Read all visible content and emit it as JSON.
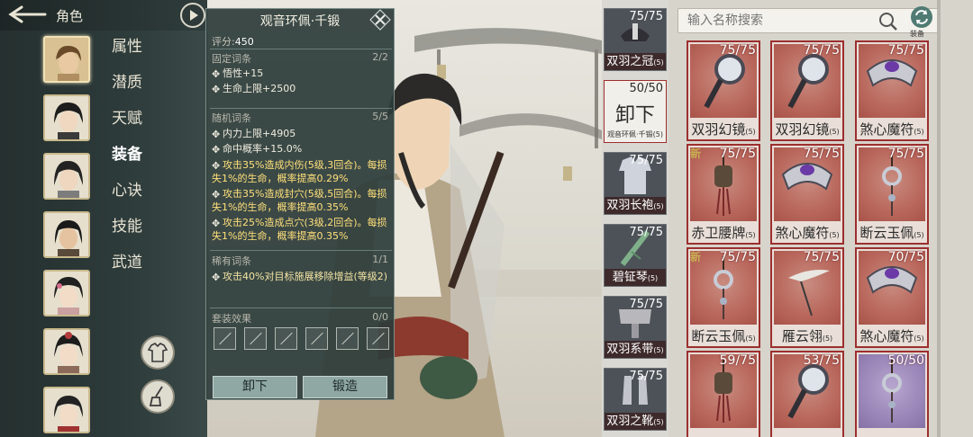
{
  "header": {
    "title": "角色"
  },
  "nav": {
    "items": [
      "属性",
      "潜质",
      "天赋",
      "装备",
      "心诀",
      "技能",
      "武道"
    ],
    "active": "装备"
  },
  "popup": {
    "title": "观音环佩·千锻",
    "score_label": "评分:",
    "score": "450",
    "fixed": {
      "label": "固定词条",
      "count": "2/2",
      "lines": [
        "悟性+15",
        "生命上限+2500"
      ]
    },
    "random": {
      "label": "随机词条",
      "count": "5/5",
      "lines": [
        "内力上限+4905",
        "命中概率+15.0%",
        "攻击35%造成内伤(5级,3回合)。每损失1%的生命，概率提高0.29%",
        "攻击35%造成封穴(5级,5回合)。每损失1%的生命，概率提高0.35%",
        "攻击25%造成点穴(3级,2回合)。每损失1%的生命，概率提高0.35%"
      ]
    },
    "rare": {
      "label": "稀有词条",
      "count": "1/1",
      "lines": [
        "攻击40%对目标施展移除增益(等级2)"
      ]
    },
    "set": {
      "label": "套装效果",
      "count": "0/0"
    },
    "unequip_label": "卸下",
    "forge_label": "锻造"
  },
  "slots": [
    {
      "name": "双羽之冠",
      "level": "(5)",
      "count": "75/75"
    },
    {
      "name": "卸下",
      "sub": "观音环佩·千锻(5)",
      "count": "50/50",
      "equipped": true
    },
    {
      "name": "双羽长袍",
      "level": "(5)",
      "count": "75/75"
    },
    {
      "name": "碧钲琴",
      "level": "(5)",
      "count": "75/75"
    },
    {
      "name": "双羽系带",
      "level": "(5)",
      "count": "75/75"
    },
    {
      "name": "双羽之靴",
      "level": "(5)",
      "count": "75/75"
    }
  ],
  "search": {
    "placeholder": "输入名称搜索"
  },
  "equip_button_label": "装备",
  "inventory": [
    {
      "name": "双羽幻镜",
      "level": "(5)",
      "count": "75/75",
      "icon": "mirror-icon",
      "tag": ""
    },
    {
      "name": "双羽幻镜",
      "level": "(5)",
      "count": "75/75",
      "icon": "mirror-icon",
      "tag": ""
    },
    {
      "name": "煞心魔符",
      "level": "(5)",
      "count": "75/75",
      "icon": "amulet-icon",
      "tag": ""
    },
    {
      "name": "赤卫腰牌",
      "level": "(5)",
      "count": "75/75",
      "icon": "tassel-icon",
      "tag": "新"
    },
    {
      "name": "煞心魔符",
      "level": "(5)",
      "count": "75/75",
      "icon": "amulet-icon",
      "tag": ""
    },
    {
      "name": "断云玉佩",
      "level": "(5)",
      "count": "75/75",
      "icon": "pendant-icon",
      "tag": ""
    },
    {
      "name": "断云玉佩",
      "level": "(5)",
      "count": "75/75",
      "icon": "pendant-icon",
      "tag": "新"
    },
    {
      "name": "雁云翎",
      "level": "(5)",
      "count": "75/75",
      "icon": "feather-icon",
      "tag": ""
    },
    {
      "name": "煞心魔符",
      "level": "(5)",
      "count": "70/75",
      "icon": "amulet-icon",
      "tag": ""
    },
    {
      "name": "",
      "level": "",
      "count": "59/75",
      "icon": "tassel-icon",
      "tag": ""
    },
    {
      "name": "",
      "level": "",
      "count": "53/75",
      "icon": "mirror-icon",
      "tag": ""
    },
    {
      "name": "",
      "level": "",
      "count": "50/50",
      "icon": "pendant-icon",
      "tag": "",
      "purple": true
    }
  ],
  "colors": {
    "accent_red": "#9c2f2f",
    "popup_bg": "#2c3c3a",
    "highlight": "#ffe07a"
  }
}
